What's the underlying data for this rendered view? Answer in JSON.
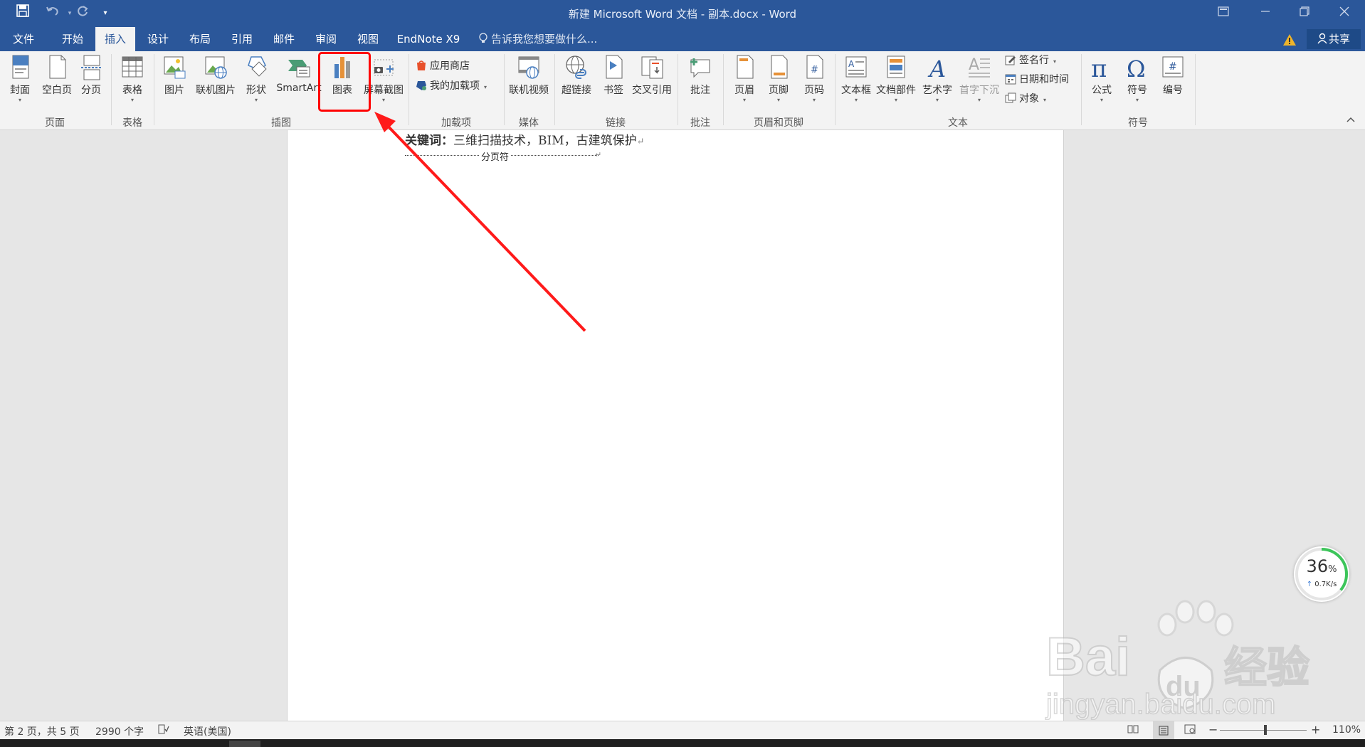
{
  "window": {
    "title": "新建 Microsoft Word 文档 - 副本.docx - Word"
  },
  "qat": {
    "save": "save-icon",
    "undo": "undo-icon",
    "redo": "redo-icon",
    "more": "▾"
  },
  "tabs": [
    {
      "label": "文件"
    },
    {
      "label": "开始"
    },
    {
      "label": "插入"
    },
    {
      "label": "设计"
    },
    {
      "label": "布局"
    },
    {
      "label": "引用"
    },
    {
      "label": "邮件"
    },
    {
      "label": "审阅"
    },
    {
      "label": "视图"
    },
    {
      "label": "EndNote X9"
    }
  ],
  "tellme": {
    "placeholder": "告诉我您想要做什么..."
  },
  "share": {
    "label": "共享"
  },
  "ribbon": {
    "pages": {
      "cover": "封面",
      "blank": "空白页",
      "break": "分页",
      "group": "页面"
    },
    "tables": {
      "table": "表格",
      "group": "表格"
    },
    "illustrations": {
      "picture": "图片",
      "online_picture": "联机图片",
      "shapes": "形状",
      "smartart": "SmartArt",
      "chart": "图表",
      "screenshot": "屏幕截图",
      "group": "插图"
    },
    "addins": {
      "store": "应用商店",
      "my_addins": "我的加载项",
      "group": "加载项"
    },
    "media": {
      "online_video": "联机视频",
      "group": "媒体"
    },
    "links": {
      "hyperlink": "超链接",
      "bookmark": "书签",
      "crossref": "交叉引用",
      "group": "链接"
    },
    "comments": {
      "comment": "批注",
      "group": "批注"
    },
    "header_footer": {
      "header": "页眉",
      "footer": "页脚",
      "page_number": "页码",
      "group": "页眉和页脚"
    },
    "text": {
      "textbox": "文本框",
      "quickparts": "文档部件",
      "wordart": "艺术字",
      "dropcap": "首字下沉",
      "signature": "签名行",
      "datetime": "日期和时间",
      "object": "对象",
      "group": "文本"
    },
    "symbols": {
      "equation": "公式",
      "symbol": "符号",
      "number": "编号",
      "group": "符号"
    }
  },
  "document": {
    "keywords_label": "关键词：",
    "keywords_text": "三维扫描技术，BIM，古建筑保护",
    "page_break": "分页符"
  },
  "status": {
    "page": "第 2 页，共 5 页",
    "words": "2990 个字",
    "language": "英语(美国)",
    "zoom": "110%"
  },
  "netmeter": {
    "percent": "36",
    "unit": "%",
    "speed": "0.7K/s",
    "level": 0.36
  },
  "watermark": {
    "line1": "Bai",
    "line2": "经验",
    "url": "jingyan.baidu.com"
  },
  "colors": {
    "word_blue": "#2b579a",
    "highlight": "#ff0000",
    "arrow": "#ff1a1a"
  }
}
